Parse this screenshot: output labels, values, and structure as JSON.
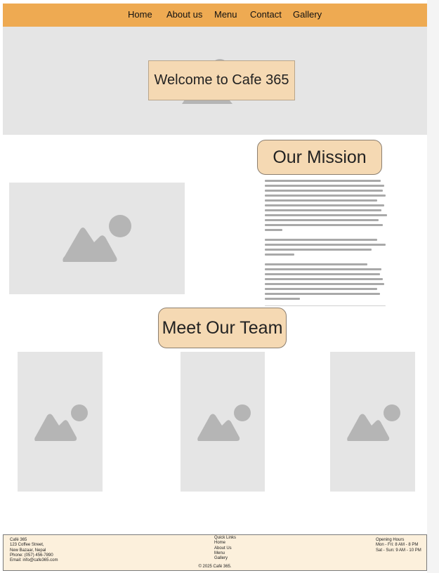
{
  "nav": {
    "items": [
      "Home",
      "About us",
      "Menu",
      "Contact",
      "Gallery"
    ]
  },
  "hero": {
    "title": "Welcome to Cafe 365"
  },
  "mission": {
    "heading": "Our Mission"
  },
  "team": {
    "heading": "Meet Our Team"
  },
  "footer": {
    "contact": [
      "Café 365",
      "123 Coffee Street,",
      "New Bazaar, Nepal",
      "Phone: (057) 456-7890",
      "Email: info@cafe365.com"
    ],
    "quick_links_title": "Quick Links",
    "quick_links": [
      "Home",
      "About Us",
      "Menu",
      "Gallery"
    ],
    "hours_title": "Opening Hours",
    "hours": [
      "Mon - Fri: 8 AM - 8 PM",
      "Sat - Sun: 9 AM - 10 PM"
    ],
    "copyright": "© 2025 Café 365."
  },
  "colors": {
    "nav": "#eeaa52",
    "accent": "#f5d9b3",
    "placeholder": "#e5e5e5",
    "footer": "#fcf0dc"
  },
  "icons": {
    "image_placeholder": "image-placeholder-icon"
  }
}
